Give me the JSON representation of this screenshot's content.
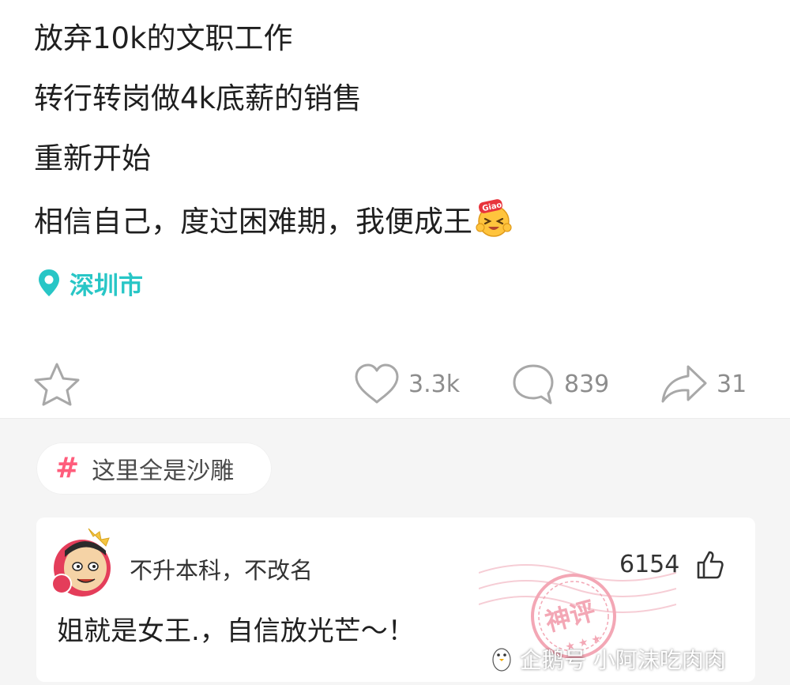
{
  "post": {
    "lines": [
      "放弃10k的文职工作",
      "转行转岗做4k底薪的销售",
      "重新开始",
      "相信自己，度过困难期，我便成王"
    ],
    "emoji_text": "Giao",
    "location": "深圳市"
  },
  "actions": {
    "likes": "3.3k",
    "comments": "839",
    "shares": "31"
  },
  "topic": {
    "label": "这里全是沙雕"
  },
  "comment": {
    "username": "不升本科，不改名",
    "likes": "6154",
    "text": "姐就是女王.，自信放光芒～！",
    "badge_text": "神评"
  },
  "watermark": "企鹅号 小阿沫吃肉肉",
  "colors": {
    "accent_teal": "#28c6c6",
    "topic_hash": "#ff5d7c",
    "stamp": "#f3a7b5"
  },
  "icons": [
    "map-pin-icon",
    "star-icon",
    "heart-icon",
    "comment-icon",
    "share-icon",
    "hash-icon",
    "thumbs-up-icon",
    "penguin-icon"
  ]
}
